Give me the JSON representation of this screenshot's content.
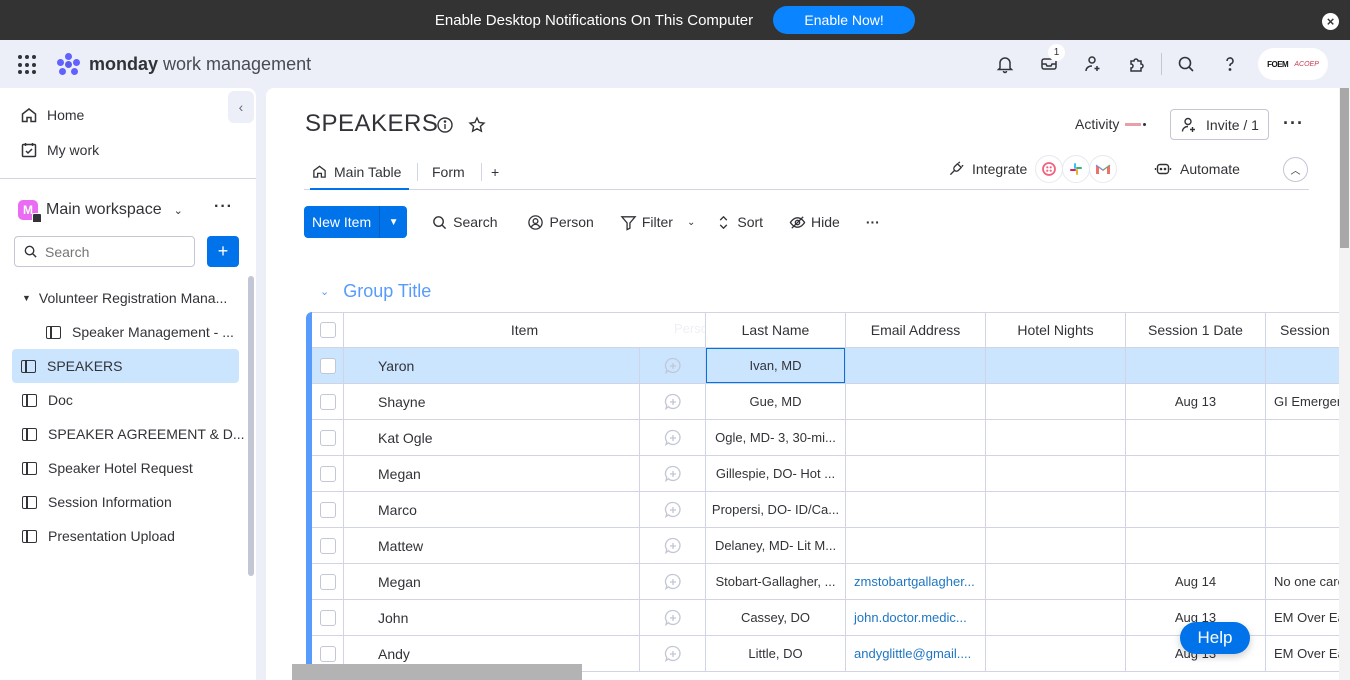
{
  "notification": {
    "text": "Enable Desktop Notifications On This Computer",
    "button": "Enable Now!",
    "close_icon": "close-circle-icon"
  },
  "header": {
    "brand_bold": "monday",
    "brand_rest": " work management",
    "inbox_badge": "1",
    "icons": [
      "apps-grid-icon",
      "bell-icon",
      "inbox-icon",
      "invite-members-icon",
      "apps-puzzle-icon",
      "search-icon",
      "help-icon"
    ],
    "account_logo_1": "FOEM",
    "account_logo_2": "ACOEP"
  },
  "sidebar": {
    "nav": [
      {
        "label": "Home",
        "icon": "home-icon"
      },
      {
        "label": "My work",
        "icon": "calendar-check-icon"
      }
    ],
    "workspace": {
      "initial": "M",
      "name": "Main workspace",
      "color": "#e96cf2"
    },
    "search_placeholder": "Search",
    "add_label": "+",
    "tree": [
      {
        "label": "Volunteer Registration Mana...",
        "type": "folder"
      },
      {
        "label": "Speaker Management - ...",
        "type": "board",
        "indent": true
      },
      {
        "label": "SPEAKERS",
        "type": "board",
        "active": true
      },
      {
        "label": "Doc",
        "type": "board"
      },
      {
        "label": "SPEAKER AGREEMENT & D...",
        "type": "board"
      },
      {
        "label": "Speaker Hotel Request",
        "type": "board"
      },
      {
        "label": "Session Information",
        "type": "board"
      },
      {
        "label": "Presentation Upload",
        "type": "board"
      }
    ]
  },
  "board": {
    "title": "SPEAKERS",
    "activity_label": "Activity",
    "invite_label": "Invite / 1",
    "tabs": [
      {
        "label": "Main Table",
        "active": true
      },
      {
        "label": "Form"
      },
      {
        "label": "+"
      }
    ],
    "integrate_label": "Integrate",
    "automate_label": "Automate",
    "integration_apps": [
      "twilio-icon",
      "slack-icon",
      "gmail-icon"
    ],
    "toolbar": {
      "new_item": "New Item",
      "search": "Search",
      "person": "Person",
      "filter": "Filter",
      "sort": "Sort",
      "hide": "Hide"
    },
    "group_title": "Group Title",
    "group_color": "#579bfc",
    "columns": [
      "Item",
      "Person",
      "Last Name",
      "Email Address",
      "Hotel Nights",
      "Session 1 Date",
      "Session"
    ],
    "rows": [
      {
        "item": "Yaron",
        "last_name": "Ivan, MD",
        "email": "",
        "hotel_nights": "",
        "session1_date": "",
        "session": "",
        "selected": true
      },
      {
        "item": "Shayne",
        "last_name": "Gue, MD",
        "email": "",
        "hotel_nights": "",
        "session1_date": "Aug 13",
        "session": "GI Emergen"
      },
      {
        "item": "Kat Ogle",
        "last_name": "Ogle, MD- 3, 30-mi...",
        "email": "",
        "hotel_nights": "",
        "session1_date": "",
        "session": ""
      },
      {
        "item": "Megan",
        "last_name": "Gillespie, DO- Hot ...",
        "email": "",
        "hotel_nights": "",
        "session1_date": "",
        "session": ""
      },
      {
        "item": "Marco",
        "last_name": "Propersi, DO- ID/Ca...",
        "email": "",
        "hotel_nights": "",
        "session1_date": "",
        "session": ""
      },
      {
        "item": "Mattew",
        "last_name": "Delaney, MD- Lit M...",
        "email": "",
        "hotel_nights": "",
        "session1_date": "",
        "session": ""
      },
      {
        "item": "Megan",
        "last_name": "Stobart-Gallagher, ...",
        "email": "zmstobartgallagher...",
        "hotel_nights": "",
        "session1_date": "Aug 14",
        "session": "No one care"
      },
      {
        "item": "John",
        "last_name": "Cassey, DO",
        "email": "john.doctor.medic...",
        "hotel_nights": "",
        "session1_date": "Aug 13",
        "session": "EM Over Ea"
      },
      {
        "item": "Andy",
        "last_name": "Little, DO",
        "email": "andyglittle@gmail....",
        "hotel_nights": "",
        "session1_date": "Aug 13",
        "session": "EM Over Ea"
      }
    ]
  },
  "help_label": "Help"
}
